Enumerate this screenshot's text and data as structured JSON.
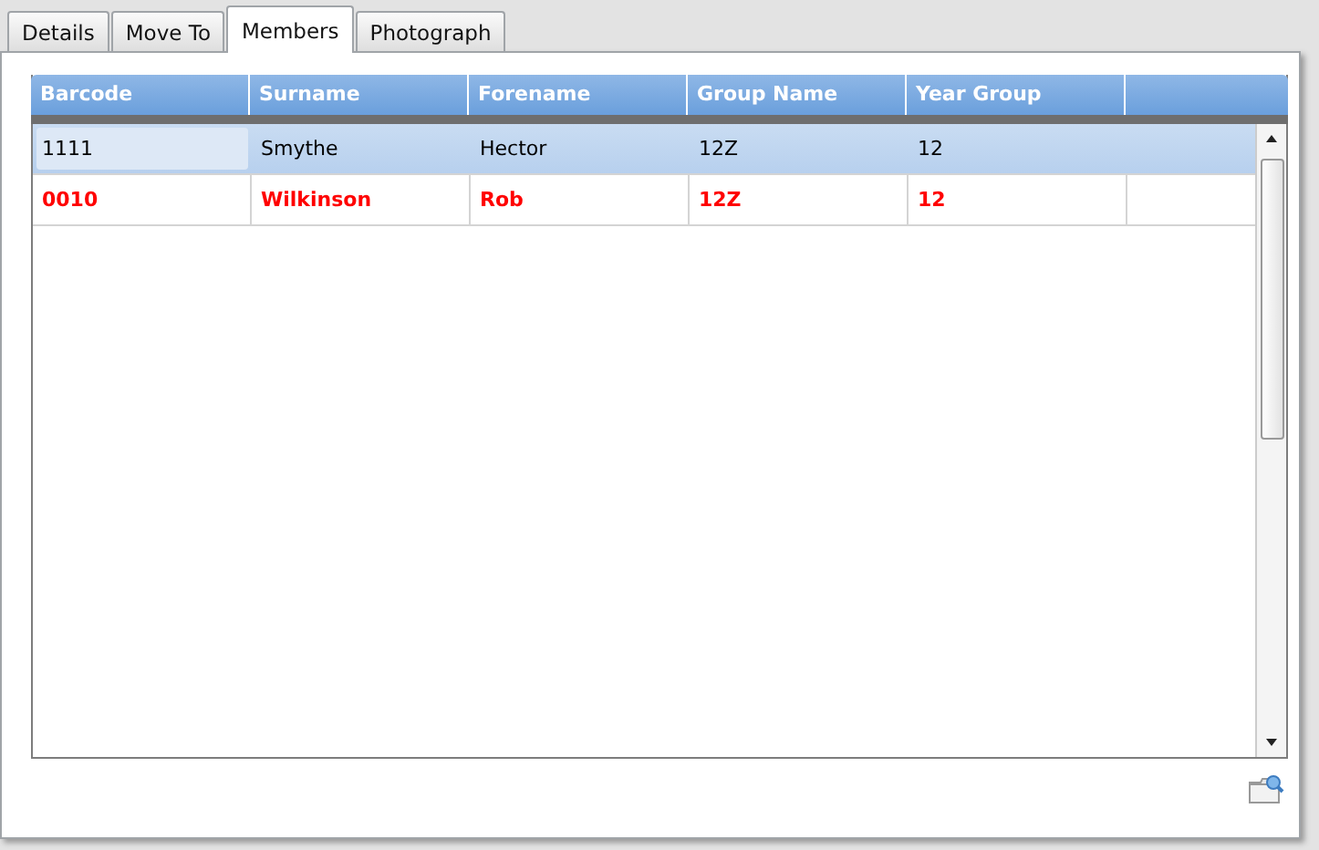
{
  "tabs": [
    {
      "label": "Details",
      "selected": false
    },
    {
      "label": "Move To",
      "selected": false
    },
    {
      "label": "Members",
      "selected": true
    },
    {
      "label": "Photograph",
      "selected": false
    }
  ],
  "table": {
    "columns": [
      "Barcode",
      "Surname",
      "Forename",
      "Group Name",
      "Year Group"
    ],
    "rows": [
      {
        "selected": true,
        "color": "#000000",
        "cells": [
          "1111",
          "Smythe",
          "Hector",
          "12Z",
          "12"
        ]
      },
      {
        "selected": false,
        "color": "#ff0000",
        "cells": [
          "0010",
          "Wilkinson",
          "Rob",
          "12Z",
          "12"
        ]
      }
    ]
  }
}
